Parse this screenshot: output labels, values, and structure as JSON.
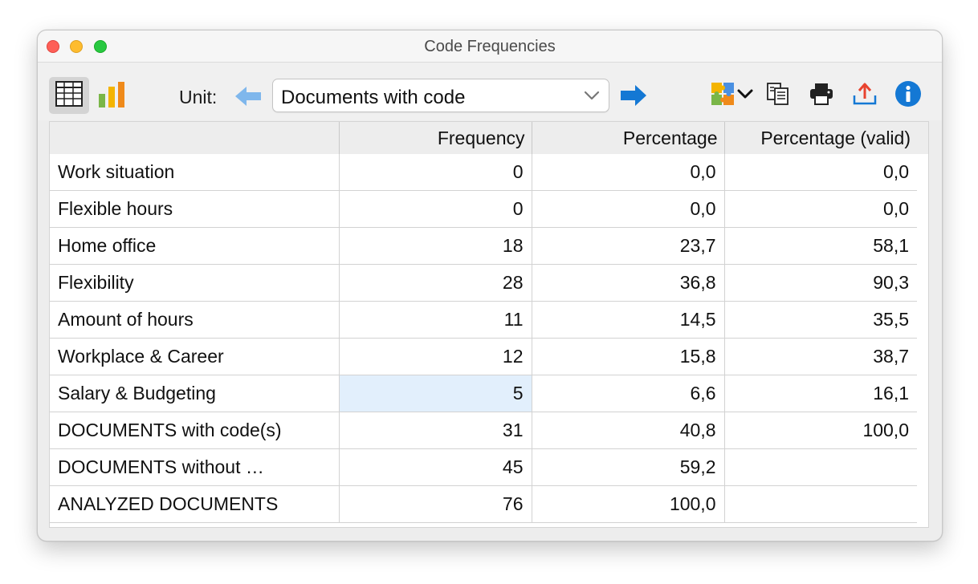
{
  "window": {
    "title": "Code Frequencies"
  },
  "toolbar": {
    "unit_label": "Unit:",
    "unit_value": "Documents with code",
    "icons": [
      "table-view-icon",
      "chart-view-icon",
      "arrow-left-icon",
      "chevron-down-icon",
      "arrow-right-icon",
      "puzzle-icon",
      "copy-icon",
      "print-icon",
      "export-icon",
      "info-icon"
    ]
  },
  "table": {
    "headers": [
      "",
      "Frequency",
      "Percentage",
      "Percentage (valid)"
    ],
    "rows": [
      {
        "label": "Work situation",
        "frequency": "0",
        "percentage": "0,0",
        "valid": "0,0"
      },
      {
        "label": "Flexible hours",
        "frequency": "0",
        "percentage": "0,0",
        "valid": "0,0"
      },
      {
        "label": "Home office",
        "frequency": "18",
        "percentage": "23,7",
        "valid": "58,1"
      },
      {
        "label": "Flexibility",
        "frequency": "28",
        "percentage": "36,8",
        "valid": "90,3"
      },
      {
        "label": "Amount of hours",
        "frequency": "11",
        "percentage": "14,5",
        "valid": "35,5"
      },
      {
        "label": "Workplace & Career",
        "frequency": "12",
        "percentage": "15,8",
        "valid": "38,7"
      },
      {
        "label": "Salary & Budgeting",
        "frequency": "5",
        "percentage": "6,6",
        "valid": "16,1"
      },
      {
        "label": "DOCUMENTS with code(s)",
        "frequency": "31",
        "percentage": "40,8",
        "valid": "100,0"
      },
      {
        "label": "DOCUMENTS without …",
        "frequency": "45",
        "percentage": "59,2",
        "valid": ""
      },
      {
        "label": "ANALYZED DOCUMENTS",
        "frequency": "76",
        "percentage": "100,0",
        "valid": ""
      }
    ]
  },
  "colors": {
    "accent": "#1478d4",
    "selection": "#e2effc",
    "arrow_left": "#7fb7ec"
  }
}
